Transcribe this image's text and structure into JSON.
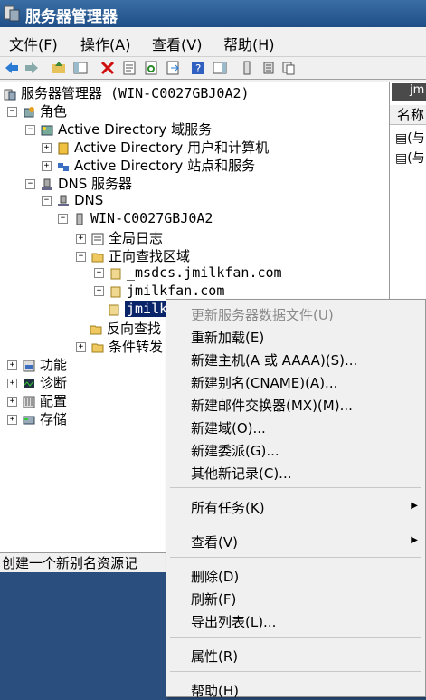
{
  "window": {
    "title": "服务器管理器"
  },
  "menu": [
    "文件(F)",
    "操作(A)",
    "查看(V)",
    "帮助(H)"
  ],
  "tree": {
    "root": "服务器管理器 (WIN-C0027GBJ0A2)",
    "roles": "角色",
    "ad_ds": "Active Directory 域服务",
    "ad_users": "Active Directory 用户和计算机",
    "ad_sites": "Active Directory 站点和服务",
    "dns_server_role": "DNS 服务器",
    "dns": "DNS",
    "server": "WIN-C0027GBJ0A2",
    "global_logs": "全局日志",
    "forward_zones": "正向查找区域",
    "msdcs_zone": "_msdcs.jmilkfan.com",
    "jmilkfan_zone": "jmilkfan.com",
    "selected_zone": "jmilk",
    "reverse_zones": "反向查找",
    "conditional": "条件转发",
    "features": "功能",
    "diagnostics": "诊断",
    "configuration": "配置",
    "storage": "存储"
  },
  "right_pane": {
    "header": "jm",
    "column": "名称",
    "rows": [
      "(与",
      "(与"
    ]
  },
  "status": "创建一个新别名资源记",
  "context_menu": {
    "update_server_data": "更新服务器数据文件(U)",
    "reload": "重新加载(E)",
    "new_host": "新建主机(A 或 AAAA)(S)...",
    "new_alias": "新建别名(CNAME)(A)...",
    "new_mx": "新建邮件交换器(MX)(M)...",
    "new_domain": "新建域(O)...",
    "new_delegation": "新建委派(G)...",
    "other_records": "其他新记录(C)...",
    "all_tasks": "所有任务(K)",
    "view": "查看(V)",
    "delete": "删除(D)",
    "refresh": "刷新(F)",
    "export": "导出列表(L)...",
    "properties": "属性(R)",
    "help": "帮助(H)"
  }
}
